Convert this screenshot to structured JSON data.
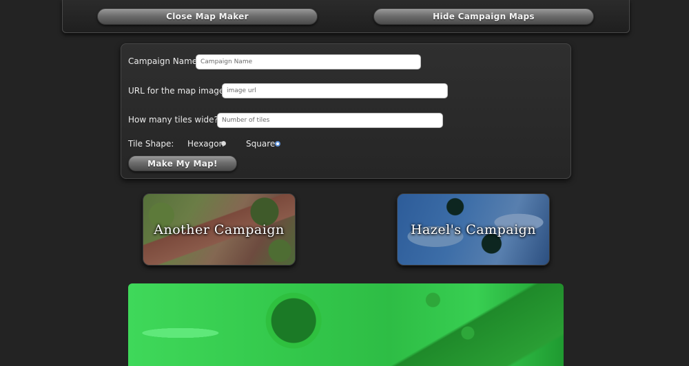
{
  "top_bar": {
    "close_label": "Close Map Maker",
    "hide_label": "Hide Campaign Maps"
  },
  "form": {
    "campaign_name_label": "Campaign Name:",
    "campaign_name_placeholder": "Campaign Name",
    "url_label": "URL for the map image:",
    "url_placeholder": "image url",
    "tiles_label": "How many tiles wide?",
    "tiles_placeholder": "Number of tiles",
    "tile_shape_label": "Tile Shape:",
    "options": [
      {
        "label": "Hexagon",
        "selected": false
      },
      {
        "label": "Square",
        "selected": true
      }
    ],
    "submit_label": "Make My Map!"
  },
  "campaigns": [
    {
      "title": "Another Campaign"
    },
    {
      "title": "Hazel's Campaign"
    }
  ],
  "colors": {
    "background": "#232323",
    "selected_radio": "#5b8fd6",
    "map_preview_tint": "#34c94c"
  }
}
